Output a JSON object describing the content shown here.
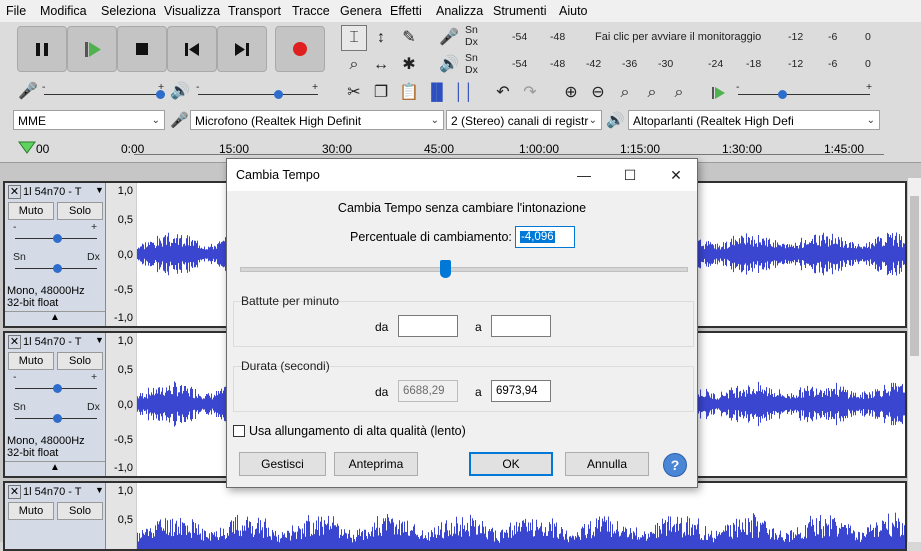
{
  "menu": [
    "File",
    "Modifica",
    "Seleziona",
    "Visualizza",
    "Transport",
    "Tracce",
    "Genera",
    "Effetti",
    "Analizza",
    "Strumenti",
    "Aiuto"
  ],
  "meters": {
    "record_channels": [
      "Sn",
      "Dx"
    ],
    "playback_channels": [
      "Sn",
      "Dx"
    ],
    "record_scale": [
      "-54",
      "-48",
      "-12",
      "-6",
      "0"
    ],
    "monitor_hint": "Fai clic per avviare il monitoraggio",
    "play_scale": [
      "-54",
      "-48",
      "-42",
      "-36",
      "-30",
      "-24",
      "-18",
      "-12",
      "-6",
      "0"
    ]
  },
  "mixer": {
    "minus": "-",
    "plus": "+"
  },
  "devices": {
    "host": "MME",
    "microphone": "Microfono (Realtek High Definit",
    "channels": "2 (Stereo) canali di registr",
    "speakers": "Altoparlanti (Realtek High Defi"
  },
  "ruler": [
    "00",
    "0:00",
    "15:00",
    "30:00",
    "45:00",
    "1:00:00",
    "1:15:00",
    "1:30:00",
    "1:45:00"
  ],
  "tracks": [
    {
      "name": "1l 54n70 - T",
      "mute": "Muto",
      "solo": "Solo",
      "pan_left": "Sn",
      "pan_right": "Dx",
      "info1": "Mono, 48000Hz",
      "info2": "32-bit float",
      "scale": [
        "1,0",
        "0,5",
        "0,0",
        "-0,5",
        "-1,0"
      ]
    },
    {
      "name": "1l 54n70 - T",
      "mute": "Muto",
      "solo": "Solo",
      "pan_left": "Sn",
      "pan_right": "Dx",
      "info1": "Mono, 48000Hz",
      "info2": "32-bit float",
      "scale": [
        "1,0",
        "0,5",
        "0,0",
        "-0,5",
        "-1,0"
      ]
    },
    {
      "name": "1l 54n70 - T",
      "mute": "Muto",
      "solo": "Solo",
      "scale": [
        "1,0",
        "0,5"
      ]
    }
  ],
  "dialog": {
    "title": "Cambia Tempo",
    "heading": "Cambia Tempo senza cambiare l'intonazione",
    "percent_label": "Percentuale di cambiamento:",
    "percent_value": "-4,096",
    "percent_slider_fraction": 0.46,
    "bpm_group": "Battute per minuto",
    "from_label": "da",
    "to_label": "a",
    "bpm_from": "",
    "bpm_to": "",
    "duration_group": "Durata (secondi)",
    "duration_from": "6688,29",
    "duration_to": "6973,94",
    "hq_label": "Usa allungamento di alta qualità (lento)",
    "hq_checked": false,
    "buttons": {
      "manage": "Gestisci",
      "preview": "Anteprima",
      "ok": "OK",
      "cancel": "Annulla",
      "help": "?"
    }
  }
}
